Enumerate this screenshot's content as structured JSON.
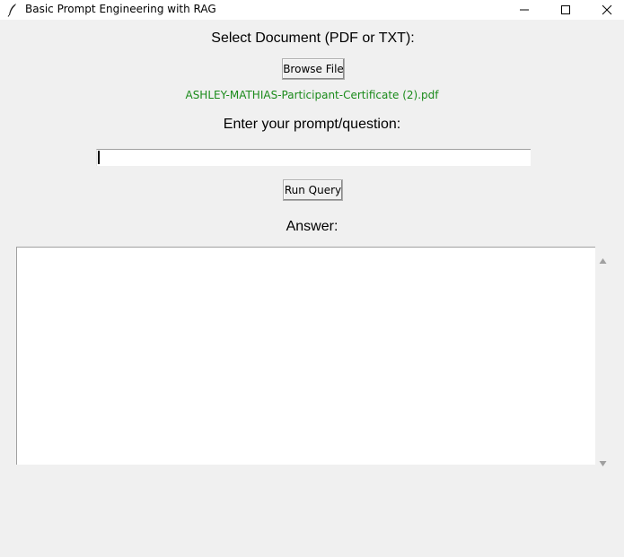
{
  "window": {
    "title": "Basic Prompt Engineering with RAG",
    "icons": {
      "app": "feather-icon",
      "minimize": "minimize-icon",
      "maximize": "maximize-icon",
      "close": "close-icon"
    }
  },
  "document_section": {
    "label": "Select Document (PDF or TXT):",
    "browse_button": "Browse File",
    "selected_file": "ASHLEY-MATHIAS-Participant-Certificate (2).pdf",
    "selected_file_color": "#1a8a1a"
  },
  "prompt_section": {
    "label": "Enter your prompt/question:",
    "input_value": "",
    "run_button": "Run Query"
  },
  "answer_section": {
    "label": "Answer:",
    "value": ""
  },
  "scrollbar": {
    "icons": {
      "up": "scroll-up-arrow-icon",
      "down": "scroll-down-arrow-icon"
    }
  }
}
